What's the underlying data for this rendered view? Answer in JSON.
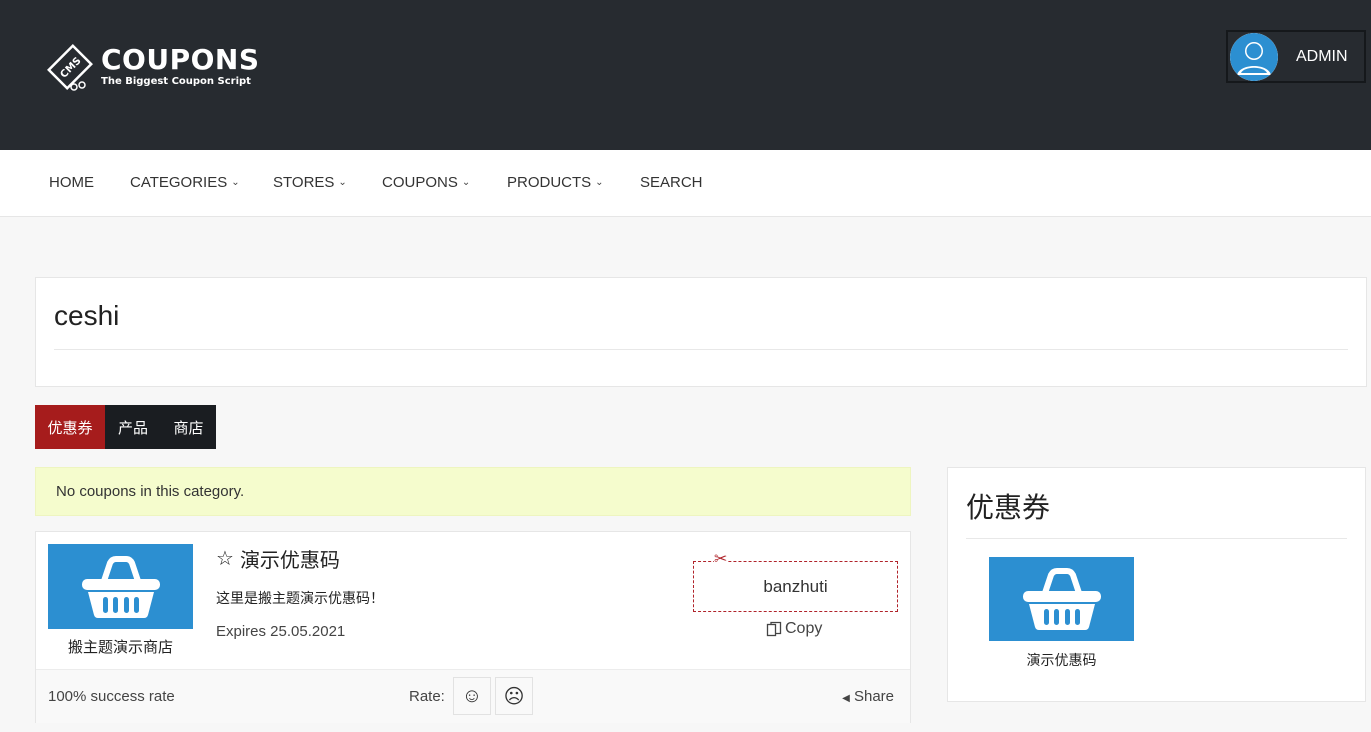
{
  "header": {
    "logo_title": "COUPONS",
    "logo_subtitle": "The Biggest Coupon Script",
    "logo_badge": "CMS",
    "user_label": "ADMIN"
  },
  "nav": {
    "items": [
      {
        "label": "HOME",
        "has_dropdown": false
      },
      {
        "label": "CATEGORIES",
        "has_dropdown": true
      },
      {
        "label": "STORES",
        "has_dropdown": true
      },
      {
        "label": "COUPONS",
        "has_dropdown": true
      },
      {
        "label": "PRODUCTS",
        "has_dropdown": true
      },
      {
        "label": "SEARCH",
        "has_dropdown": false
      }
    ]
  },
  "page": {
    "title": "ceshi"
  },
  "tabs": [
    {
      "label": "优惠券",
      "active": true
    },
    {
      "label": "产品",
      "active": false
    },
    {
      "label": "商店",
      "active": false
    }
  ],
  "notice": "No coupons in this category.",
  "coupon": {
    "store_name": "搬主题演示商店",
    "title": "演示优惠码",
    "description": "这里是搬主题演示优惠码！",
    "expires": "Expires 25.05.2021",
    "code": "banzhuti",
    "copy_label": "Copy",
    "success_rate": "100% success rate",
    "rate_label": "Rate:",
    "share_label": "Share"
  },
  "sidebar": {
    "title": "优惠券",
    "item_label": "演示优惠码"
  },
  "colors": {
    "header_bg": "#272b30",
    "accent_red": "#a61c1c",
    "tab_dark": "#1a1d21",
    "notice_bg": "#f5fccd",
    "store_blue": "#2c8fd1"
  }
}
